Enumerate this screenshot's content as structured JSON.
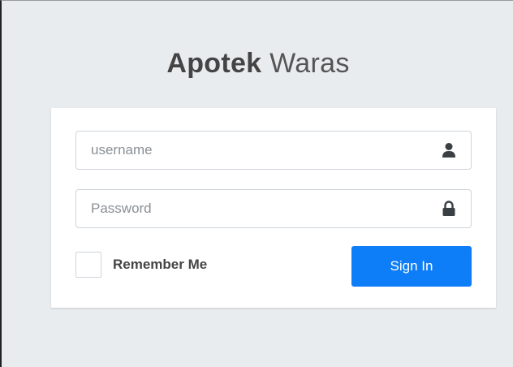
{
  "brand": {
    "name_bold": "Apotek",
    "name_light": "Waras"
  },
  "login": {
    "username_placeholder": "username",
    "username_value": "",
    "username_icon": "user-icon",
    "password_placeholder": "Password",
    "password_value": "",
    "password_icon": "lock-icon",
    "remember_label": "Remember Me",
    "remember_checked": false,
    "signin_label": "Sign In"
  },
  "colors": {
    "page_background": "#e9ecef",
    "card_background": "#ffffff",
    "primary_button": "#0d7df8",
    "text": "#444444"
  }
}
